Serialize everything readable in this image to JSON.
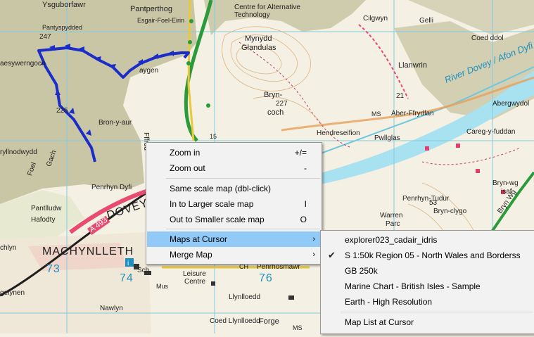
{
  "map": {
    "labels": {
      "ysguborfawr": "Ysguborfawr",
      "pantperthog": "Pantperthog",
      "esgair": "Esgair-Foel-Eirin",
      "cat_line1": "Centre for Alternative",
      "cat_line2": "Technology",
      "cilgwyn": "Cilgwyn",
      "gelli": "Gelli",
      "coed_ddol": "Coed ddol",
      "pantyspydded": "Pantyspydded",
      "h247": "247",
      "aesywerngoch": "aesywerngoch",
      "mynydd": "Mynydd",
      "glandulas": "Glandulas",
      "llanwrin": "Llanwrin",
      "aygen": "aygen",
      "bryn": "Bryn-",
      "h227": "227",
      "coch": "coch",
      "r21": "21",
      "ms1": "MS",
      "aber": "Aber-Ffrydlan",
      "abergwydol": "Abergwydol",
      "river": "River Dovey / Afon Dyfi",
      "h225": "225",
      "bron": "Bron-y-aur",
      "hendre": "Hendreseifion",
      "careg": "Careg-y-fuddan",
      "pwllglas": "Pwllglas",
      "fffrdd": "Fffrdd",
      "r15": "15",
      "nodwydd": "ryllnodwydd",
      "foel": "Foel",
      "gach": "Gach",
      "penrhyn": "Penrhyn Dyfi",
      "brynwg1": "Bryn-wg",
      "brynwg2": "isaf",
      "pantlludw": "Pantlludw",
      "a493": "A 493",
      "dovey": "DOVEY",
      "hafodty": "Hafodty",
      "penrhyn_t": "Penrhyn-Tudur",
      "r53": "53",
      "warren1": "Warren",
      "warren2": "Parc",
      "clygo": "Bryn-clygo",
      "brynwg_r": "Bryn Wg",
      "chlyn": "chlyn",
      "machynlleth": "MACHYNLLETH",
      "r73": "73",
      "r74": "74",
      "r76": "76",
      "sch": "Sch",
      "chi": "CH",
      "penrhos": "Penrhosmawr",
      "leisure1": "Leisure",
      "leisure2": "Centre",
      "mus": "Mus",
      "gelynen": "gelynen",
      "llynlloedd": "Llynlloedd",
      "nawlyn": "Nawlyn",
      "coedlloedd": "Coed Llynlloedd",
      "forge": "Forge",
      "ms2": "MS"
    },
    "colors": {
      "background": "#f4f0e3",
      "forest": "#c4c1a1",
      "route": "#1a2dc8",
      "river": "#8fd8ea",
      "road_a": "#e8476a",
      "grid": "#7dc8e0",
      "railway": "#2d9a3a"
    }
  },
  "context_menu": {
    "items": [
      {
        "label": "Zoom in",
        "shortcut": "+/="
      },
      {
        "label": "Zoom out",
        "shortcut": "-"
      },
      {
        "label": "Same scale map (dbl-click)",
        "shortcut": ""
      },
      {
        "label": "In to Larger scale map",
        "shortcut": "I"
      },
      {
        "label": "Out to Smaller scale map",
        "shortcut": "O"
      },
      {
        "label": "Maps at Cursor",
        "shortcut": ""
      },
      {
        "label": "Merge Map",
        "shortcut": ""
      }
    ],
    "arrow_glyph": "›",
    "highlighted": "Maps at Cursor"
  },
  "submenu": {
    "items": [
      {
        "label": "explorer023_cadair_idris",
        "checked": false
      },
      {
        "label": "S 1:50k Region 05 - North Wales and Borderss",
        "checked": true
      },
      {
        "label": "GB 250k",
        "checked": false
      },
      {
        "label": "Marine Chart - British Isles - Sample",
        "checked": false
      },
      {
        "label": "Earth - High Resolution",
        "checked": false
      },
      {
        "label": "Map List at Cursor",
        "checked": false
      }
    ],
    "check_glyph": "✔"
  }
}
